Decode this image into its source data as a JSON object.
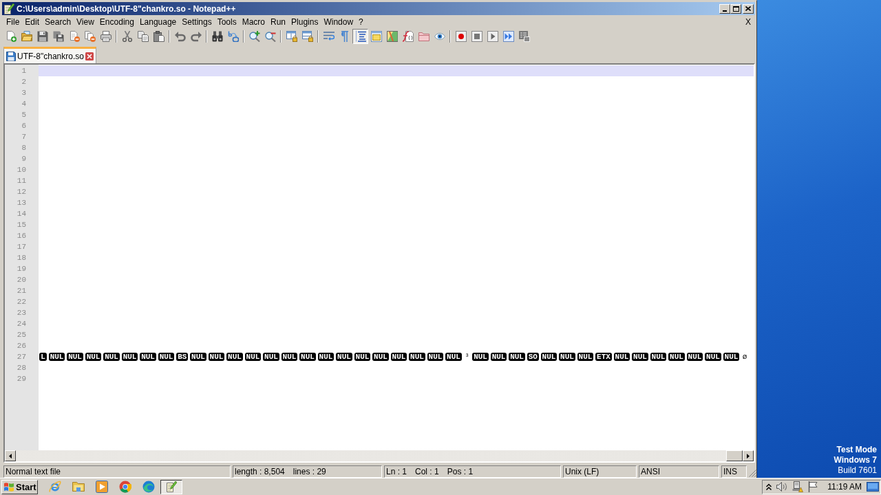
{
  "window": {
    "title": "C:\\Users\\admin\\Desktop\\UTF-8\"chankro.so - Notepad++"
  },
  "menu_bar": {
    "items": [
      "File",
      "Edit",
      "Search",
      "View",
      "Encoding",
      "Language",
      "Settings",
      "Tools",
      "Macro",
      "Run",
      "Plugins",
      "Window",
      "?"
    ],
    "close_document": "X"
  },
  "toolbar": {
    "groups": [
      [
        {
          "kind": "new",
          "pressed": false
        },
        {
          "kind": "open",
          "pressed": false
        },
        {
          "kind": "save",
          "pressed": false
        },
        {
          "kind": "saveall",
          "pressed": false
        },
        {
          "kind": "close",
          "pressed": false
        },
        {
          "kind": "closeall",
          "pressed": false
        },
        {
          "kind": "print",
          "pressed": false
        }
      ],
      [
        {
          "kind": "cut",
          "pressed": false
        },
        {
          "kind": "copy",
          "pressed": false
        },
        {
          "kind": "paste",
          "pressed": false
        }
      ],
      [
        {
          "kind": "undo",
          "pressed": false
        },
        {
          "kind": "redo",
          "pressed": false
        }
      ],
      [
        {
          "kind": "find",
          "pressed": false
        },
        {
          "kind": "replace",
          "pressed": false
        }
      ],
      [
        {
          "kind": "zoomin",
          "pressed": false
        },
        {
          "kind": "zoomout",
          "pressed": false
        }
      ],
      [
        {
          "kind": "syncv",
          "pressed": false
        },
        {
          "kind": "synch",
          "pressed": false
        }
      ],
      [
        {
          "kind": "wrap",
          "pressed": false
        },
        {
          "kind": "symbols",
          "pressed": false
        },
        {
          "kind": "indent",
          "pressed": true
        },
        {
          "kind": "udl",
          "pressed": false
        },
        {
          "kind": "docmap",
          "pressed": false
        },
        {
          "kind": "functions",
          "pressed": false
        },
        {
          "kind": "workspace",
          "pressed": false
        },
        {
          "kind": "monitor",
          "pressed": false
        }
      ],
      [
        {
          "kind": "record",
          "pressed": false
        },
        {
          "kind": "stop",
          "pressed": false
        },
        {
          "kind": "play",
          "pressed": false
        },
        {
          "kind": "playmany",
          "pressed": false
        },
        {
          "kind": "savemacro",
          "pressed": false
        }
      ]
    ]
  },
  "tabs": [
    {
      "label": "UTF-8\"chankro.so",
      "selected": true
    }
  ],
  "editor": {
    "lines": [
      {
        "number": "1",
        "current": true
      },
      {
        "number": "2",
        "current": false
      },
      {
        "number": "3",
        "current": false
      },
      {
        "number": "4",
        "current": false
      },
      {
        "number": "5",
        "current": false
      },
      {
        "number": "6",
        "current": false
      },
      {
        "number": "7",
        "current": false
      },
      {
        "number": "8",
        "current": false
      },
      {
        "number": "9",
        "current": false
      },
      {
        "number": "10",
        "current": false
      },
      {
        "number": "11",
        "current": false
      },
      {
        "number": "12",
        "current": false
      },
      {
        "number": "13",
        "current": false
      },
      {
        "number": "14",
        "current": false
      },
      {
        "number": "15",
        "current": false
      },
      {
        "number": "16",
        "current": false
      },
      {
        "number": "17",
        "current": false
      },
      {
        "number": "18",
        "current": false
      },
      {
        "number": "19",
        "current": false
      },
      {
        "number": "20",
        "current": false
      },
      {
        "number": "21",
        "current": false
      },
      {
        "number": "22",
        "current": false
      },
      {
        "number": "23",
        "current": false
      },
      {
        "number": "24",
        "current": false
      },
      {
        "number": "25",
        "current": false
      },
      {
        "number": "26",
        "current": false
      },
      {
        "number": "27",
        "current": false,
        "tokens": [
          {
            "kind": "control",
            "text": "L"
          },
          {
            "kind": "control",
            "text": "NUL"
          },
          {
            "kind": "control",
            "text": "NUL"
          },
          {
            "kind": "control",
            "text": "NUL"
          },
          {
            "kind": "control",
            "text": "NUL"
          },
          {
            "kind": "control",
            "text": "NUL"
          },
          {
            "kind": "control",
            "text": "NUL"
          },
          {
            "kind": "control",
            "text": "NUL"
          },
          {
            "kind": "control",
            "text": "BS"
          },
          {
            "kind": "control",
            "text": "NUL"
          },
          {
            "kind": "control",
            "text": "NUL"
          },
          {
            "kind": "control",
            "text": "NUL"
          },
          {
            "kind": "control",
            "text": "NUL"
          },
          {
            "kind": "control",
            "text": "NUL"
          },
          {
            "kind": "control",
            "text": "NUL"
          },
          {
            "kind": "control",
            "text": "NUL"
          },
          {
            "kind": "control",
            "text": "NUL"
          },
          {
            "kind": "control",
            "text": "NUL"
          },
          {
            "kind": "control",
            "text": "NUL"
          },
          {
            "kind": "control",
            "text": "NUL"
          },
          {
            "kind": "control",
            "text": "NUL"
          },
          {
            "kind": "control",
            "text": "NUL"
          },
          {
            "kind": "control",
            "text": "NUL"
          },
          {
            "kind": "control",
            "text": "NUL"
          },
          {
            "kind": "char",
            "text": "³"
          },
          {
            "kind": "control",
            "text": "NUL"
          },
          {
            "kind": "control",
            "text": "NUL"
          },
          {
            "kind": "control",
            "text": "NUL"
          },
          {
            "kind": "control",
            "text": "SO"
          },
          {
            "kind": "control",
            "text": "NUL"
          },
          {
            "kind": "control",
            "text": "NUL"
          },
          {
            "kind": "control",
            "text": "NUL"
          },
          {
            "kind": "control",
            "text": "ETX"
          },
          {
            "kind": "control",
            "text": "NUL"
          },
          {
            "kind": "control",
            "text": "NUL"
          },
          {
            "kind": "control",
            "text": "NUL"
          },
          {
            "kind": "control",
            "text": "NUL"
          },
          {
            "kind": "control",
            "text": "NUL"
          },
          {
            "kind": "control",
            "text": "NUL"
          },
          {
            "kind": "control",
            "text": "NUL"
          },
          {
            "kind": "char",
            "text": "ø"
          }
        ]
      },
      {
        "number": "28",
        "current": false
      },
      {
        "number": "29",
        "current": false
      }
    ]
  },
  "status_bar": {
    "panels": [
      [
        "Normal text file"
      ],
      [
        "length : 8,504",
        "lines : 29"
      ],
      [
        "Ln : 1",
        "Col : 1",
        "Pos : 1"
      ],
      [
        "Unix (LF)"
      ],
      [
        "ANSI"
      ],
      [
        "INS"
      ]
    ]
  },
  "desktop": {
    "notice": [
      {
        "text": "Test Mode",
        "bold": true
      },
      {
        "text": "Windows 7",
        "bold": true
      },
      {
        "text": "Build 7601",
        "bold": false
      }
    ]
  },
  "taskbar": {
    "start": "Start",
    "tasks": [
      {
        "active": true
      }
    ],
    "clock": "11:19 AM"
  }
}
